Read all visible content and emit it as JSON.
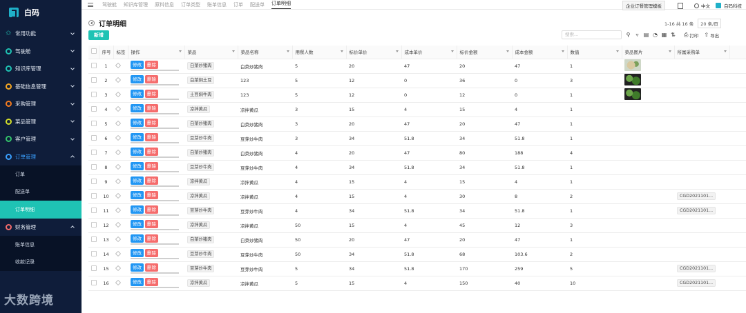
{
  "brand": {
    "name": "白码"
  },
  "sidebar": {
    "items": [
      {
        "label": "常用功能",
        "color": "#1fc3b4",
        "star": true,
        "open": false
      },
      {
        "label": "驾驶舱",
        "color": "#1fc3b4"
      },
      {
        "label": "知识库管理",
        "color": "#1fc3b4"
      },
      {
        "label": "基础信息管理",
        "color": "#f5a623"
      },
      {
        "label": "采购管理",
        "color": "#f57c1f"
      },
      {
        "label": "菜品管理",
        "color": "#d4e02a"
      },
      {
        "label": "客户管理",
        "color": "#33c46b"
      },
      {
        "label": "订单管理",
        "color": "#3aa0ff",
        "open": true,
        "active": true,
        "children": [
          "订单",
          "配送单",
          "订单明细"
        ],
        "active_child": 2
      },
      {
        "label": "财务管理",
        "color": "#f56c6c",
        "open": true,
        "children": [
          "账单信息",
          "收款记录"
        ]
      }
    ],
    "watermark": "大数跨境"
  },
  "topbar": {
    "tabs": [
      "驾驶舱",
      "知识库管理",
      "原料信息",
      "订单类型",
      "账单信息",
      "订单",
      "配送单",
      "订单明细"
    ],
    "active_tab": 7,
    "template_button": "企业订餐管理模板",
    "lang": "中文",
    "company": "白码科技"
  },
  "page": {
    "title": "订单明细",
    "pager_text": "1-16 共 16 条",
    "page_size": "20 条/页",
    "add_button": "新增",
    "search_placeholder": "搜索...",
    "print_label": "打印",
    "export_label": "导出"
  },
  "table": {
    "columns": [
      "序号",
      "标签",
      "操作",
      "菜品",
      "菜品名称",
      "用餐人数",
      "标价单价",
      "成本单价",
      "标价金额",
      "成本金额",
      "数值",
      "菜品图片",
      "所属采购单"
    ],
    "edit_label": "修改",
    "delete_label": "删除",
    "rows": [
      {
        "no": "1",
        "dish": "白菜炒猪肉",
        "name": "白菜炒猪肉",
        "people": "5",
        "price": "20",
        "cost": "47",
        "amount": "20",
        "cost_amount": "47",
        "qty": "1",
        "img": "light",
        "po": ""
      },
      {
        "no": "2",
        "dish": "白菜焖土豆",
        "name": "123",
        "people": "5",
        "price": "12",
        "cost": "0",
        "amount": "36",
        "cost_amount": "0",
        "qty": "3",
        "img": "dark",
        "po": ""
      },
      {
        "no": "3",
        "dish": "土豆焖牛肉",
        "name": "123",
        "people": "5",
        "price": "12",
        "cost": "0",
        "amount": "12",
        "cost_amount": "0",
        "qty": "1",
        "img": "dark",
        "po": ""
      },
      {
        "no": "4",
        "dish": "凉拌黄瓜",
        "name": "凉拌黄瓜",
        "people": "3",
        "price": "15",
        "cost": "4",
        "amount": "15",
        "cost_amount": "4",
        "qty": "1",
        "img": "",
        "po": ""
      },
      {
        "no": "5",
        "dish": "白菜炒猪肉",
        "name": "白菜炒猪肉",
        "people": "3",
        "price": "20",
        "cost": "47",
        "amount": "20",
        "cost_amount": "47",
        "qty": "1",
        "img": "",
        "po": ""
      },
      {
        "no": "6",
        "dish": "豆芽炒牛肉",
        "name": "豆芽炒牛肉",
        "people": "3",
        "price": "34",
        "cost": "51.8",
        "amount": "34",
        "cost_amount": "51.8",
        "qty": "1",
        "img": "",
        "po": ""
      },
      {
        "no": "7",
        "dish": "白菜炒猪肉",
        "name": "白菜炒猪肉",
        "people": "4",
        "price": "20",
        "cost": "47",
        "amount": "80",
        "cost_amount": "188",
        "qty": "4",
        "img": "",
        "po": ""
      },
      {
        "no": "8",
        "dish": "豆芽炒牛肉",
        "name": "豆芽炒牛肉",
        "people": "4",
        "price": "34",
        "cost": "51.8",
        "amount": "34",
        "cost_amount": "51.8",
        "qty": "1",
        "img": "",
        "po": ""
      },
      {
        "no": "9",
        "dish": "凉拌黄瓜",
        "name": "凉拌黄瓜",
        "people": "4",
        "price": "15",
        "cost": "4",
        "amount": "15",
        "cost_amount": "4",
        "qty": "1",
        "img": "",
        "po": ""
      },
      {
        "no": "10",
        "dish": "凉拌黄瓜",
        "name": "凉拌黄瓜",
        "people": "4",
        "price": "15",
        "cost": "4",
        "amount": "30",
        "cost_amount": "8",
        "qty": "2",
        "img": "",
        "po": "CGD2021101..."
      },
      {
        "no": "11",
        "dish": "豆芽炒牛肉",
        "name": "豆芽炒牛肉",
        "people": "4",
        "price": "34",
        "cost": "51.8",
        "amount": "34",
        "cost_amount": "51.8",
        "qty": "1",
        "img": "",
        "po": "CGD2021101..."
      },
      {
        "no": "12",
        "dish": "凉拌黄瓜",
        "name": "凉拌黄瓜",
        "people": "50",
        "price": "15",
        "cost": "4",
        "amount": "45",
        "cost_amount": "12",
        "qty": "3",
        "img": "",
        "po": ""
      },
      {
        "no": "13",
        "dish": "白菜炒猪肉",
        "name": "白菜炒猪肉",
        "people": "50",
        "price": "20",
        "cost": "47",
        "amount": "20",
        "cost_amount": "47",
        "qty": "1",
        "img": "",
        "po": ""
      },
      {
        "no": "14",
        "dish": "豆芽炒牛肉",
        "name": "豆芽炒牛肉",
        "people": "50",
        "price": "34",
        "cost": "51.8",
        "amount": "68",
        "cost_amount": "103.6",
        "qty": "2",
        "img": "",
        "po": ""
      },
      {
        "no": "15",
        "dish": "豆芽炒牛肉",
        "name": "豆芽炒牛肉",
        "people": "5",
        "price": "34",
        "cost": "51.8",
        "amount": "170",
        "cost_amount": "259",
        "qty": "5",
        "img": "",
        "po": "CGD2021101..."
      },
      {
        "no": "16",
        "dish": "凉拌黄瓜",
        "name": "凉拌黄瓜",
        "people": "5",
        "price": "15",
        "cost": "4",
        "amount": "150",
        "cost_amount": "40",
        "qty": "10",
        "img": "",
        "po": "CGD2021101..."
      }
    ]
  }
}
